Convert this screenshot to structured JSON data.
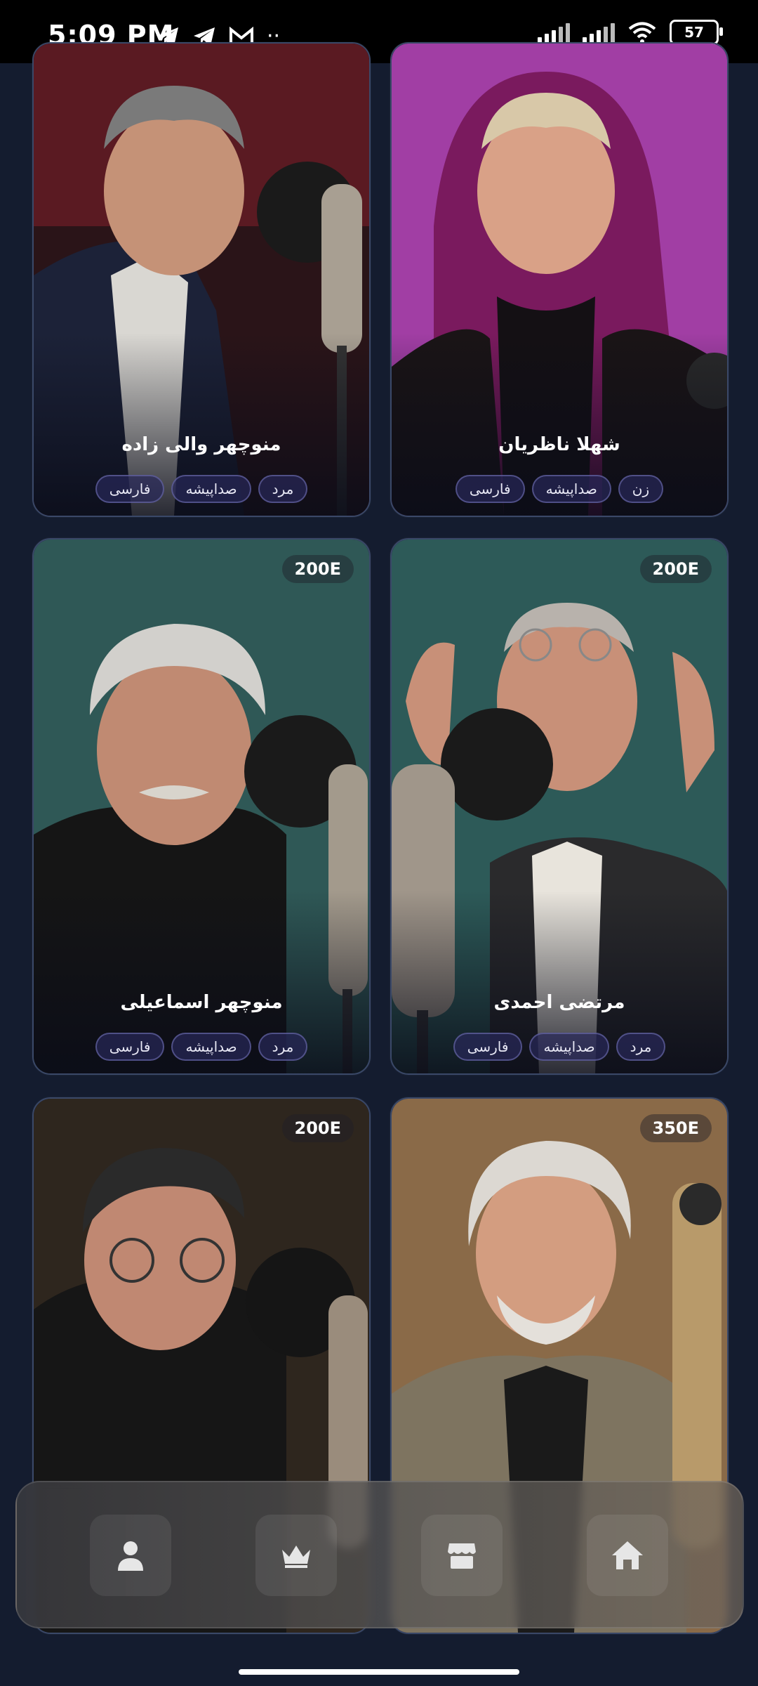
{
  "status_bar": {
    "time": "5:09 PM",
    "battery": "57",
    "icons": [
      "telegram-icon",
      "telegram-icon",
      "gmail-icon",
      "more-dots-icon",
      "signal-icon",
      "signal-icon",
      "wifi-icon",
      "battery-icon"
    ]
  },
  "cards": [
    {
      "name": "منوچهر والی زاده",
      "price": "",
      "tags": [
        "مرد",
        "صداپیشه",
        "فارسی"
      ],
      "bg": "#3a2024",
      "skin": "#c59277"
    },
    {
      "name": "شهلا ناظریان",
      "price": "",
      "tags": [
        "زن",
        "صداپیشه",
        "فارسی"
      ],
      "bg": "#9a3c9a",
      "skin": "#d9a187"
    },
    {
      "name": "منوچهر اسماعیلی",
      "price": "200E",
      "tags": [
        "مرد",
        "صداپیشه",
        "فارسی"
      ],
      "bg": "#2f5856",
      "skin": "#c08a72"
    },
    {
      "name": "مرتضی احمدی",
      "price": "200E",
      "tags": [
        "مرد",
        "صداپیشه",
        "فارسی"
      ],
      "bg": "#2d5a58",
      "skin": "#c89078"
    },
    {
      "name": "",
      "price": "200E",
      "tags": [],
      "bg": "#2e261e",
      "skin": "#c08872"
    },
    {
      "name": "",
      "price": "350E",
      "tags": [],
      "bg": "#8a6a48",
      "skin": "#d39d80"
    }
  ],
  "nav": {
    "items": [
      {
        "icon": "profile-icon"
      },
      {
        "icon": "crown-icon"
      },
      {
        "icon": "store-icon"
      },
      {
        "icon": "home-icon"
      }
    ]
  }
}
